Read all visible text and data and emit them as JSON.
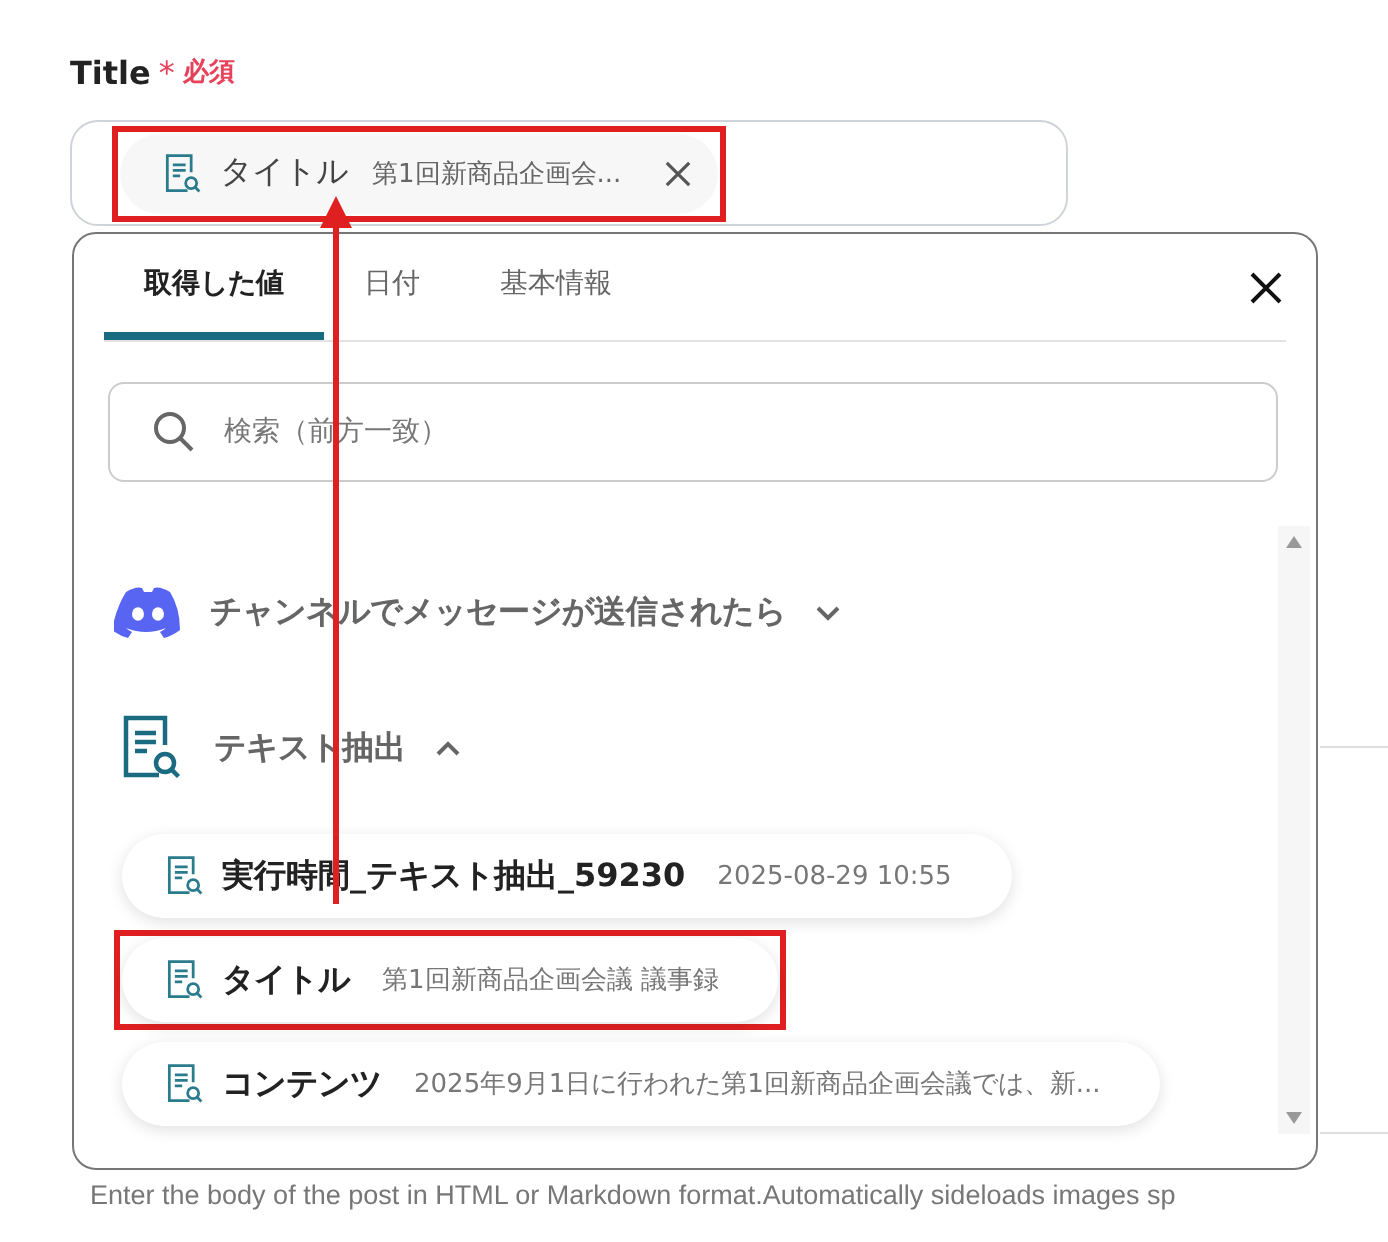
{
  "field": {
    "label": "Title",
    "required_mark": "*",
    "required_text": "必須",
    "chip": {
      "name": "タイトル",
      "value": "第1回新商品企画会...",
      "highlighted": true
    }
  },
  "background_hint": "Enter the body of the post in HTML or Markdown format.Automatically sideloads images sp",
  "popup": {
    "tabs": [
      {
        "label": "取得した値",
        "selected": true
      },
      {
        "label": "日付",
        "selected": false
      },
      {
        "label": "基本情報",
        "selected": false
      }
    ],
    "search": {
      "placeholder": "検索（前方一致）"
    },
    "groups": [
      {
        "kind": "discord",
        "label": "チャンネルでメッセージが送信されたら",
        "expanded": false
      },
      {
        "kind": "document",
        "label": "テキスト抽出",
        "expanded": true,
        "items": [
          {
            "name": "実行時間_テキスト抽出_59230",
            "value": "2025-08-29 10:55",
            "highlighted": false
          },
          {
            "name": "タイトル",
            "value": "第1回新商品企画会議 議事録",
            "highlighted": true
          },
          {
            "name": "コンテンツ",
            "value": "2025年9月1日に行われた第1回新商品企画会議では、新...",
            "highlighted": false
          }
        ]
      }
    ]
  }
}
